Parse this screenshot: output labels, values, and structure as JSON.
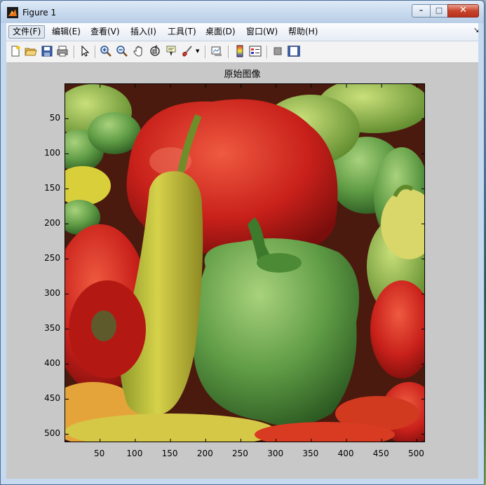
{
  "window": {
    "title": "Figure 1",
    "icon": "matlab-icon",
    "controls": [
      "minimize-icon",
      "maximize-icon",
      "close-icon"
    ],
    "control_glyphs": {
      "minimize": "–",
      "maximize": "□",
      "close": "✕"
    }
  },
  "menubar": {
    "items": [
      {
        "label": "文件(F)",
        "active": true
      },
      {
        "label": "编辑(E)"
      },
      {
        "label": "查看(V)"
      },
      {
        "label": "插入(I)"
      },
      {
        "label": "工具(T)"
      },
      {
        "label": "桌面(D)"
      },
      {
        "label": "窗口(W)"
      },
      {
        "label": "帮助(H)"
      }
    ],
    "overflow_glyph": "↘"
  },
  "toolbar": {
    "icons": [
      "new-figure-icon",
      "open-file-icon",
      "save-icon",
      "print-icon",
      "pointer-icon",
      "zoom-in-icon",
      "zoom-out-icon",
      "pan-icon",
      "rotate-3d-icon",
      "data-cursor-icon",
      "brush-icon",
      "dropdown-arrow-icon",
      "link-plot-icon",
      "colorbar-icon",
      "legend-icon",
      "hide-plot-tools-icon",
      "show-plot-tools-icon"
    ]
  },
  "figure": {
    "title": "原始图像",
    "y_ticks": [
      "50",
      "100",
      "150",
      "200",
      "250",
      "300",
      "350",
      "400",
      "450",
      "500"
    ],
    "x_ticks": [
      "50",
      "100",
      "150",
      "200",
      "250",
      "300",
      "350",
      "400",
      "450",
      "500"
    ],
    "image_subject": "peppers",
    "colors": {
      "background": "#c8c8c8",
      "red_pepper": "#c8201a",
      "green_pepper": "#5f9c45",
      "yellow_pepper": "#c9c43c"
    }
  }
}
